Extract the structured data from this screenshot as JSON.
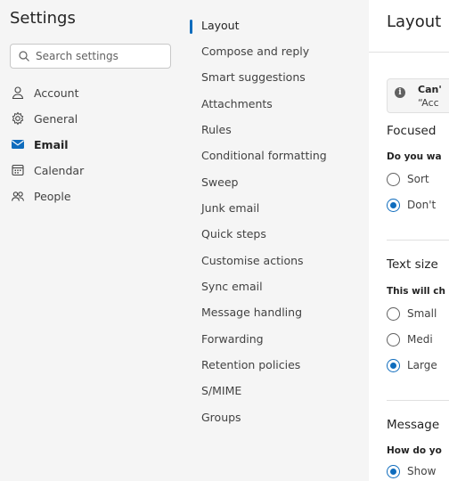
{
  "nav": {
    "title": "Settings",
    "search_placeholder": "Search settings",
    "items": [
      {
        "label": "Account",
        "icon": "person-icon"
      },
      {
        "label": "General",
        "icon": "gear-icon"
      },
      {
        "label": "Email",
        "icon": "mail-icon",
        "active": true
      },
      {
        "label": "Calendar",
        "icon": "calendar-icon"
      },
      {
        "label": "People",
        "icon": "people-icon"
      }
    ]
  },
  "submenu": {
    "items": [
      {
        "label": "Layout",
        "active": true
      },
      {
        "label": "Compose and reply"
      },
      {
        "label": "Smart suggestions"
      },
      {
        "label": "Attachments"
      },
      {
        "label": "Rules"
      },
      {
        "label": "Conditional formatting"
      },
      {
        "label": "Sweep"
      },
      {
        "label": "Junk email"
      },
      {
        "label": "Quick steps"
      },
      {
        "label": "Customise actions"
      },
      {
        "label": "Sync email"
      },
      {
        "label": "Message handling"
      },
      {
        "label": "Forwarding"
      },
      {
        "label": "Retention policies"
      },
      {
        "label": "S/MIME"
      },
      {
        "label": "Groups"
      }
    ]
  },
  "panel": {
    "title": "Layout",
    "info": {
      "line1": "Can'",
      "line2": "“Acc"
    },
    "focused": {
      "heading": "Focused",
      "question": "Do you wa",
      "options": [
        {
          "label": "Sort",
          "selected": false
        },
        {
          "label": "Don't",
          "selected": true
        }
      ]
    },
    "text_size": {
      "heading": "Text size",
      "question": "This will ch",
      "options": [
        {
          "label": "Small",
          "selected": false
        },
        {
          "label": "Medi",
          "selected": false
        },
        {
          "label": "Large",
          "selected": true
        }
      ]
    },
    "message": {
      "heading": "Message",
      "question": "How do yo",
      "options": [
        {
          "label": "Show",
          "selected": true
        }
      ]
    }
  },
  "colors": {
    "accent": "#0f6cbd",
    "nav_bg": "#f5f5f5"
  }
}
